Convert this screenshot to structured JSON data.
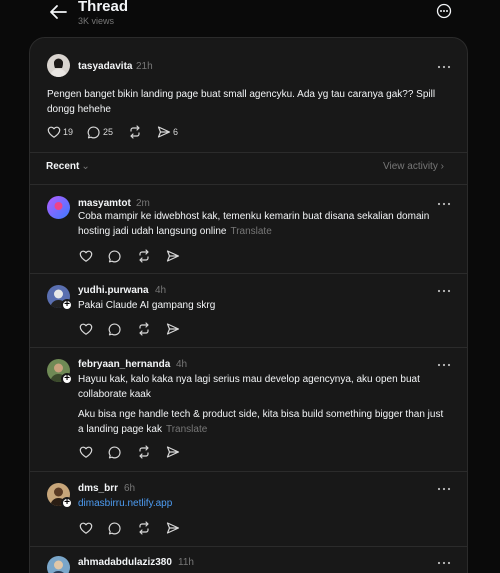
{
  "header": {
    "title": "Thread",
    "views": "3K views"
  },
  "original_post": {
    "username": "tasyadavita",
    "time": "21h",
    "text": "Pengen banget bikin landing page buat small agencyku. Ada yg tau caranya gak?? Spill dongg hehehe",
    "likes": "19",
    "replies": "25",
    "shares": "6"
  },
  "filter": {
    "label": "Recent",
    "chevron": "⌄",
    "view_activity": "View activity",
    "view_activity_chevron": "›"
  },
  "replies": [
    {
      "username": "masyamtot",
      "time": "2m",
      "text": "Coba mampir ke idwebhost kak, temenku kemarin buat disana sekalian domain hosting jadi udah langsung online",
      "translate": "Translate"
    },
    {
      "username": "yudhi.purwana",
      "time": "4h",
      "text": "Pakai Claude AI gampang skrg"
    },
    {
      "username": "febryaan_hernanda",
      "time": "4h",
      "text": "Hayuu kak, kalo kaka nya lagi serius mau develop agencynya, aku open buat collaborate kaak",
      "text2": "Aku bisa nge handle tech & product side, kita bisa build something bigger than just a landing page kak",
      "translate": "Translate"
    },
    {
      "username": "dms_brr",
      "time": "6h",
      "link": "dimasbirru.netlify.app"
    },
    {
      "username": "ahmadabdulaziz380",
      "time": "11h"
    }
  ],
  "colors": {
    "background": "#0a0a0a",
    "panel": "#181818",
    "link": "#4d9cf2",
    "muted": "#777777"
  }
}
